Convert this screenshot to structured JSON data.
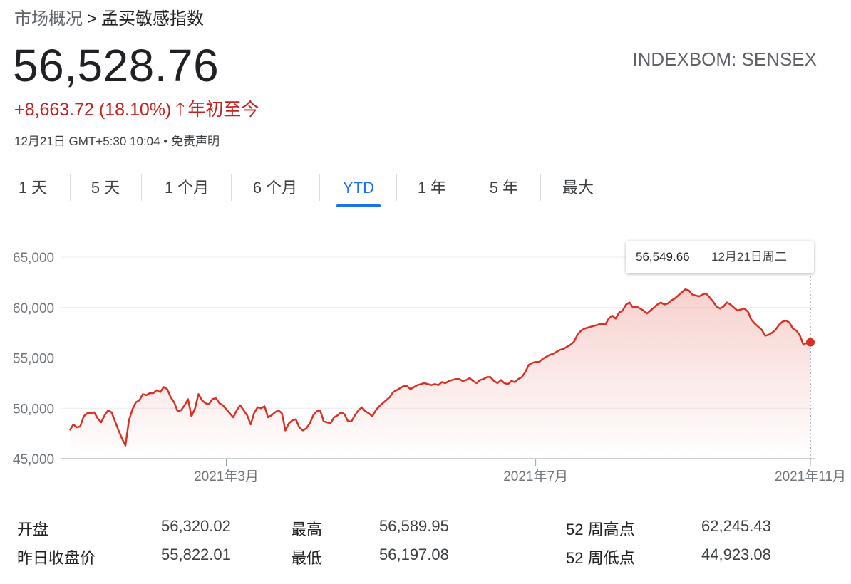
{
  "breadcrumb": {
    "parent": "市场概况",
    "separator": ">",
    "current": "孟买敏感指数"
  },
  "quote": {
    "price": "56,528.76",
    "ticker": "INDEXBOM: SENSEX",
    "change": "+8,663.72 (18.10%)",
    "change_arrow": "🡑",
    "change_period": "年初至今",
    "timestamp": "12月21日 GMT+5:30 10:04",
    "bullet": "•",
    "disclaimer": "免责声明",
    "change_color": "#c5221f"
  },
  "tabs": [
    {
      "label": "1 天"
    },
    {
      "label": "5 天"
    },
    {
      "label": "1 个月"
    },
    {
      "label": "6 个月"
    },
    {
      "label": "YTD",
      "active": true
    },
    {
      "label": "1 年"
    },
    {
      "label": "5 年"
    },
    {
      "label": "最大"
    }
  ],
  "tooltip": {
    "value": "56,549.66",
    "date": "12月21日周二"
  },
  "stats": {
    "open_label": "开盘",
    "open_value": "56,320.02",
    "prev_close_label": "昨日收盘价",
    "prev_close_value": "55,822.01",
    "high_label": "最高",
    "high_value": "56,589.95",
    "low_label": "最低",
    "low_value": "56,197.08",
    "wk52_high_label": "52 周高点",
    "wk52_high_value": "62,245.43",
    "wk52_low_label": "52 周低点",
    "wk52_low_value": "44,923.08"
  },
  "chart_data": {
    "type": "area",
    "series": [
      {
        "values": [
          47800,
          48400,
          48100,
          48200,
          49200,
          49500,
          49500,
          49600,
          49000,
          48600,
          49300,
          49800,
          49600,
          48700,
          47800,
          47000,
          46300,
          48800,
          49900,
          50600,
          50800,
          51400,
          51300,
          51500,
          51500,
          51800,
          51600,
          52100,
          51900,
          51100,
          50600,
          49700,
          49800,
          50300,
          50900,
          49200,
          50000,
          51400,
          50800,
          50500,
          50400,
          50900,
          51000,
          50500,
          50300,
          49900,
          49500,
          49100,
          49800,
          50300,
          49800,
          49300,
          48400,
          49500,
          50100,
          50000,
          50200,
          49100,
          49300,
          49600,
          49800,
          49500,
          47800,
          48500,
          48800,
          48900,
          48100,
          47800,
          48000,
          48500,
          49300,
          49700,
          49800,
          48700,
          48600,
          48500,
          49100,
          49300,
          49600,
          49400,
          48700,
          48700,
          49300,
          49800,
          50100,
          49700,
          49500,
          49200,
          49800,
          50200,
          50500,
          50800,
          51100,
          51600,
          51800,
          52000,
          52200,
          52200,
          51900,
          52100,
          52300,
          52400,
          52500,
          52400,
          52300,
          52400,
          52300,
          52600,
          52500,
          52700,
          52800,
          52900,
          52900,
          52700,
          52800,
          53000,
          52700,
          52500,
          52800,
          52900,
          53100,
          53100,
          52700,
          52500,
          52800,
          52500,
          52400,
          52700,
          52600,
          52900,
          53100,
          53600,
          54300,
          54500,
          54600,
          54600,
          54900,
          55100,
          55300,
          55400,
          55600,
          55800,
          55900,
          56100,
          56300,
          56600,
          57300,
          57700,
          57900,
          58000,
          58100,
          58200,
          58300,
          58400,
          58300,
          58900,
          59200,
          58900,
          59500,
          59700,
          60300,
          60500,
          60000,
          60100,
          59900,
          59700,
          59400,
          59700,
          60000,
          60300,
          60500,
          60300,
          60400,
          60700,
          60900,
          61200,
          61500,
          61800,
          61700,
          61300,
          61200,
          61100,
          61300,
          61400,
          61000,
          60600,
          60100,
          59900,
          60100,
          60500,
          60300,
          60000,
          59700,
          59800,
          59900,
          59600,
          58800,
          58400,
          58100,
          57800,
          57200,
          57300,
          57500,
          57800,
          58300,
          58600,
          58700,
          58500,
          57900,
          57700,
          57200,
          56300,
          56500,
          56550
        ]
      }
    ],
    "xlabel": "",
    "ylabel": "",
    "ylim": [
      45000,
      65000
    ],
    "yticks": [
      "45,000",
      "50,000",
      "55,000",
      "60,000",
      "65,000"
    ],
    "xticks": [
      "2021年3月",
      "2021年7月",
      "2021年11月"
    ],
    "xtick_index": [
      45,
      134,
      213
    ],
    "grid": true,
    "line_color": "#d93025",
    "fill_color": "#d93025"
  }
}
